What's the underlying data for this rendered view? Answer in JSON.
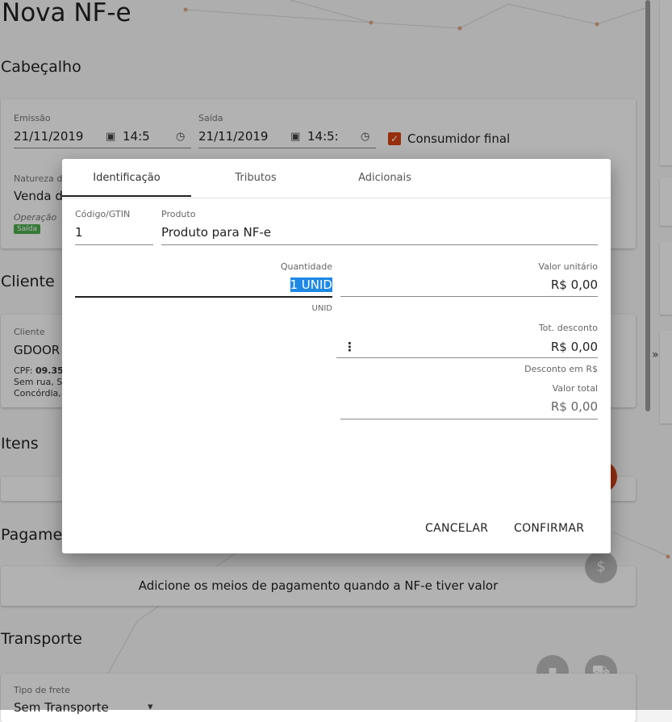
{
  "page": {
    "title": "Nova NF-e",
    "sections": {
      "header": "Cabeçalho",
      "client": "Cliente",
      "items": "Itens",
      "payment": "Pagamen",
      "transport": "Transporte"
    },
    "header": {
      "emission_label": "Emissão",
      "emission_date": "21/11/2019",
      "emission_time": "14:5",
      "exit_label": "Saída",
      "exit_date": "21/11/2019",
      "exit_time": "14:5:",
      "final_consumer_label": "Consumidor final",
      "final_consumer_checked": true,
      "nature_label": "Natureza d",
      "nature_value": "Venda d",
      "operation_label": "Operação",
      "operation_badge": "Saída"
    },
    "client": {
      "label": "Cliente",
      "value": "GDOOR",
      "cpf_prefix": "CPF: ",
      "cpf_value": "09.35",
      "address1": "Sem rua, S",
      "address2": "Concórdia,"
    },
    "payment": {
      "hint": "Adicione os meios de pagamento quando a NF-e tiver valor"
    },
    "transport": {
      "freight_label": "Tipo de frete",
      "freight_value": "Sem Transporte"
    }
  },
  "dialog": {
    "tabs": [
      {
        "label": "Identificação",
        "active": true
      },
      {
        "label": "Tributos",
        "active": false
      },
      {
        "label": "Adicionais",
        "active": false
      }
    ],
    "code_label": "Código/GTIN",
    "code_value": "1",
    "product_label": "Produto",
    "product_value": "Produto para NF-e",
    "quantity_label": "Quantidade",
    "quantity_value": "1 UNID",
    "quantity_hint": "UNID",
    "unit_value_label": "Valor unitário",
    "unit_value": "R$ 0,00",
    "discount_label": "Tot. desconto",
    "discount_value": "R$ 0,00",
    "discount_hint": "Desconto em R$",
    "total_label": "Valor total",
    "total_value": "R$ 0,00",
    "cancel": "CANCELAR",
    "confirm": "CONFIRMAR"
  },
  "icons": {
    "accent": "#d84315",
    "badge": "#4caf50"
  }
}
